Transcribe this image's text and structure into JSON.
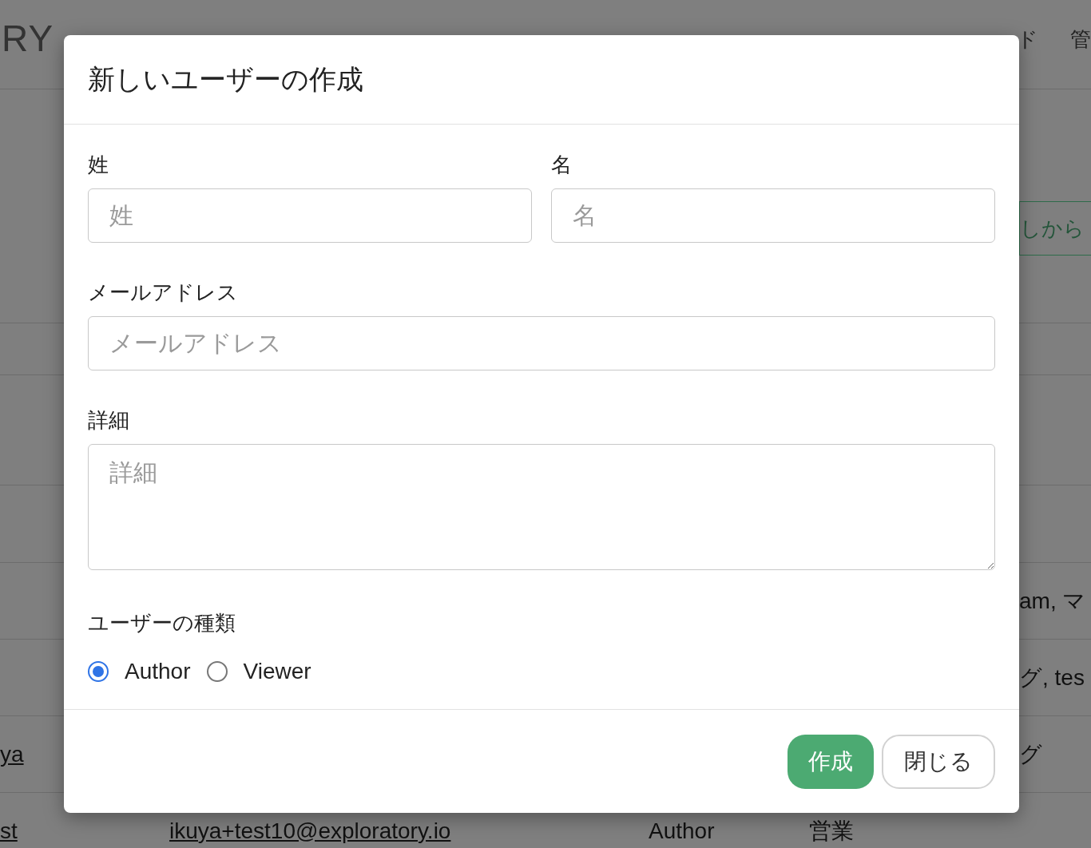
{
  "background": {
    "logo": "RY",
    "nav": [
      "ド",
      "管"
    ],
    "header_button": "しから",
    "rows": [
      {
        "column_5": "am, マ"
      },
      {
        "column_5": "グ, tes"
      },
      {
        "column_1": "ya",
        "column_5": "グ"
      },
      {
        "column_1": "st",
        "column_2": "ikuya+test10@exploratory.io",
        "column_3": "Author",
        "column_4": "営業"
      }
    ]
  },
  "dialog": {
    "title": "新しいユーザーの作成",
    "fields": [
      {
        "label": "姓",
        "placeholder": "姓",
        "kind": "half"
      },
      {
        "label": "名",
        "placeholder": "名",
        "kind": "half"
      },
      {
        "label": "メールアドレス",
        "placeholder": "メールアドレス",
        "kind": "full"
      },
      {
        "label": "詳細",
        "placeholder": "詳細",
        "kind": "textarea"
      }
    ],
    "user_type": {
      "label": "ユーザーの種類",
      "options": [
        {
          "label": "Author",
          "selected": true
        },
        {
          "label": "Viewer",
          "selected": false
        }
      ]
    },
    "buttons": [
      {
        "label": "作成",
        "kind": "primary"
      },
      {
        "label": "閉じる",
        "kind": "secondary"
      }
    ]
  }
}
